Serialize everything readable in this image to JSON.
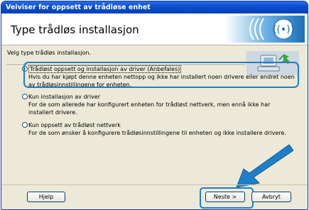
{
  "window": {
    "title": "Veiviser for oppsett av trådløse enhet"
  },
  "header": {
    "title": "Type trådløs installasjon"
  },
  "body": {
    "instruction": "Velg type trådløs installasjon.",
    "options": [
      {
        "label": "Trådløst oppsett og installasjon av driver (Anbefales)",
        "desc": "Hvis du har kjøpt denne enheten nettopp og ikke har installert noen drivere eller endret noen av trådløsinnstillingene for enheten.",
        "selected": true
      },
      {
        "label": "Kun installasjon av driver",
        "desc": "For de som allerede har konfigurert enheten for trådløst nettverk, men ennå ikke har installert drivere.",
        "selected": false
      },
      {
        "label": "Kun oppsett av trådløst nettverk",
        "desc": "For de som ønsker å konfigurere trådløsinnstillingene til enheten og ikke installere drivere.",
        "selected": false
      }
    ]
  },
  "footer": {
    "help_label": "Hjelp",
    "next_label": "Neste >",
    "cancel_label": "Avbryt"
  },
  "colors": {
    "highlight": "#1e7fc9",
    "titlebar": "#0a4fd0"
  },
  "icons": {
    "logo": "wireless-logo-icon",
    "pc": "computer-network-icon",
    "arrow": "pointer-arrow-icon"
  }
}
